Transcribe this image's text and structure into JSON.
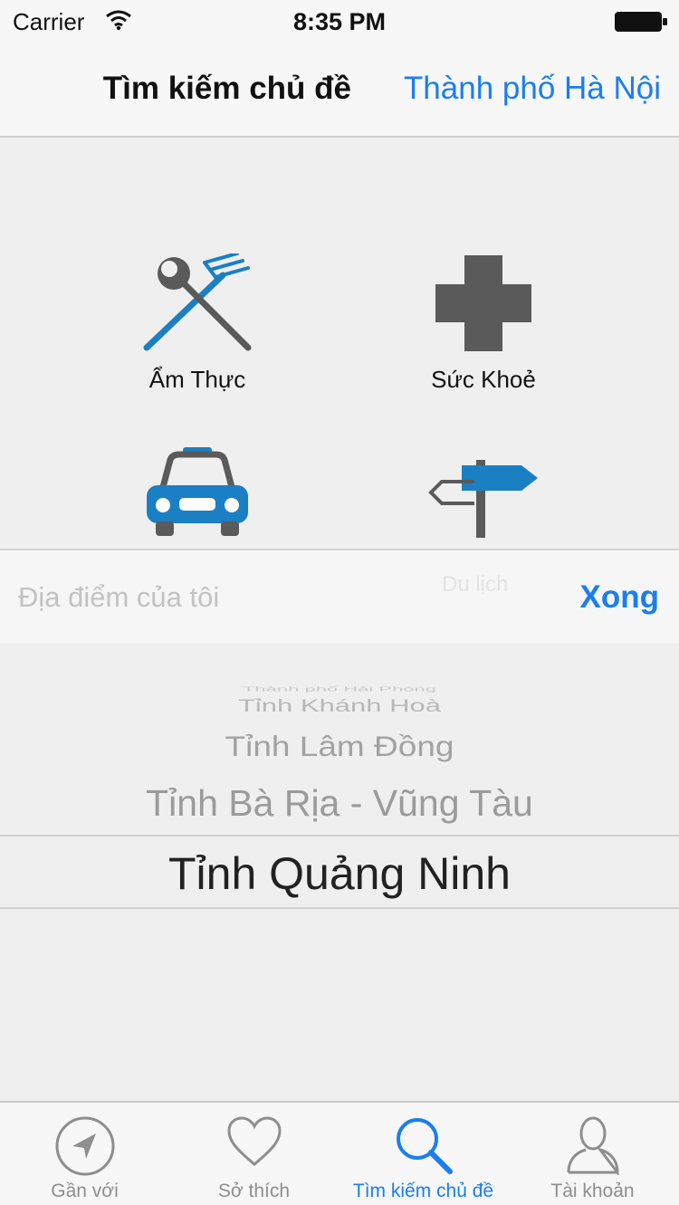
{
  "status_bar": {
    "carrier": "Carrier",
    "time": "8:35 PM"
  },
  "nav": {
    "title": "Tìm kiếm chủ đề",
    "city": "Thành phố Hà Nội"
  },
  "categories": [
    {
      "label": "Ẩm Thực",
      "icon": "dining-icon"
    },
    {
      "label": "Sức Khoẻ",
      "icon": "health-cross-icon"
    },
    {
      "label": "",
      "icon": "taxi-icon"
    },
    {
      "label": "",
      "icon": "signpost-icon"
    }
  ],
  "picker": {
    "placeholder": "Địa điểm của tôi",
    "done_label": "Xong",
    "ghost_label": "Du lịch",
    "items": [
      "Thành phố Hải Phòng",
      "Tỉnh Khánh Hoà",
      "Tỉnh Lâm Đồng",
      "Tỉnh Bà Rịa - Vũng Tàu",
      "Tỉnh Quảng Ninh"
    ],
    "selected_index": 4
  },
  "tabs": [
    {
      "label": "Gần với",
      "icon": "location-arrow-icon",
      "active": false
    },
    {
      "label": "Sở thích",
      "icon": "heart-icon",
      "active": false
    },
    {
      "label": "Tìm kiếm chủ đề",
      "icon": "search-icon",
      "active": true
    },
    {
      "label": "Tài khoản",
      "icon": "person-icon",
      "active": false
    }
  ],
  "colors": {
    "accent": "#1a7ef0",
    "icon_blue": "#1b7fc4",
    "icon_gray": "#5a5a5a"
  }
}
